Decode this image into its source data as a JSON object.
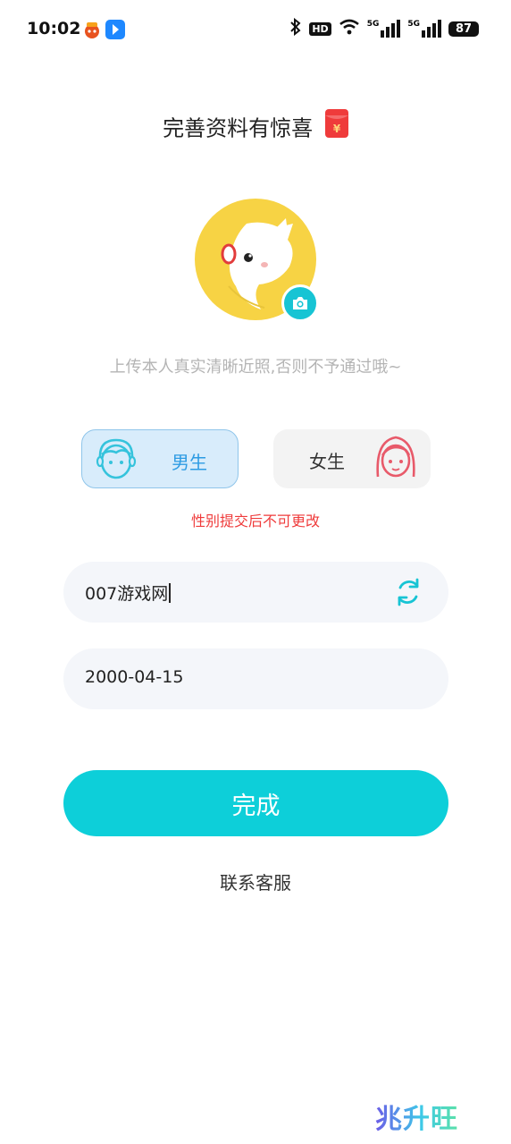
{
  "status_bar": {
    "time": "10:02",
    "battery": "87",
    "hd_label": "HD",
    "network_labels": [
      "5G",
      "5G"
    ]
  },
  "header": {
    "title": "完善资料有惊喜",
    "title_icon": "red-packet-icon"
  },
  "avatar": {
    "icon": "default-avatar-cat",
    "camera_icon": "camera-icon",
    "hint": "上传本人真实清晰近照,否则不予通过哦~"
  },
  "gender": {
    "male_label": "男生",
    "female_label": "女生",
    "selected": "male",
    "warning": "性别提交后不可更改"
  },
  "form": {
    "nickname_value": "007游戏网",
    "birthday_value": "2000-04-15",
    "refresh_icon": "refresh-icon"
  },
  "actions": {
    "done_label": "完成",
    "contact_label": "联系客服"
  },
  "watermark": {
    "text": "兆升旺"
  },
  "colors": {
    "accent": "#0dcfd9",
    "male_accent": "#2d9be3",
    "female_accent": "#e85a6a",
    "warning": "#ef3b3b"
  }
}
